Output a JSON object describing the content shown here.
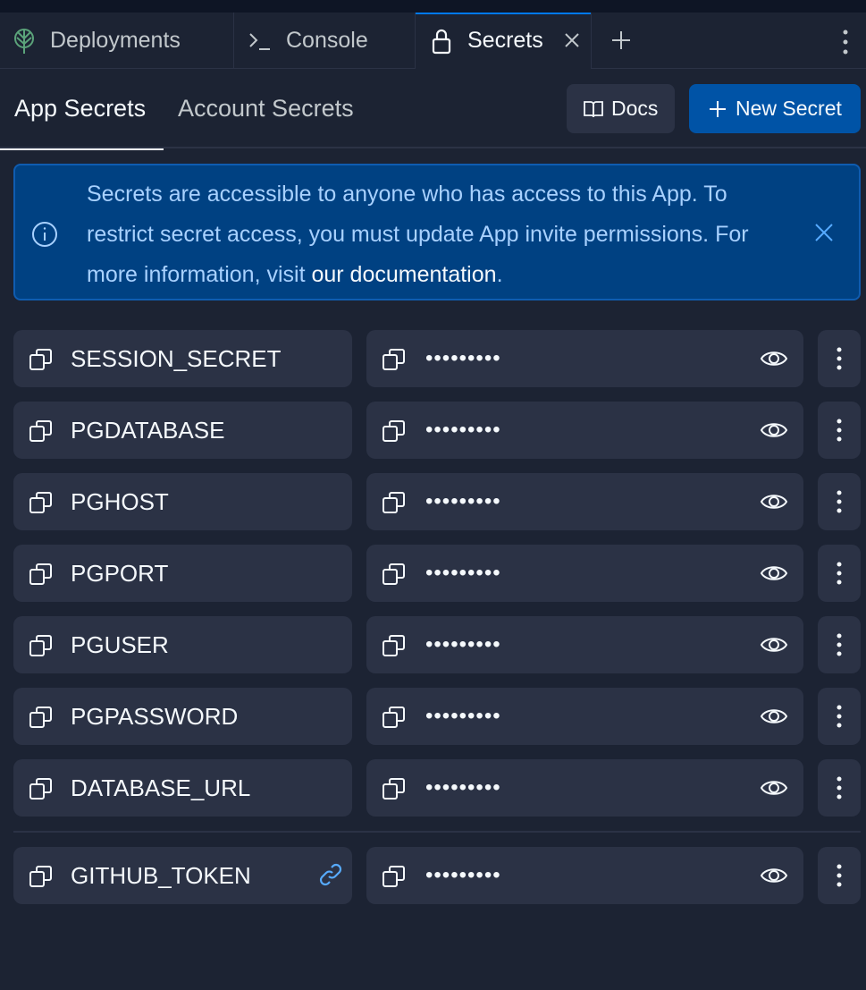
{
  "tabs": [
    {
      "label": "Deployments",
      "icon": "deployments-icon"
    },
    {
      "label": "Console",
      "icon": "console-icon"
    },
    {
      "label": "Secrets",
      "icon": "lock-icon",
      "active": true
    }
  ],
  "subtabs": {
    "app": "App Secrets",
    "account": "Account Secrets"
  },
  "buttons": {
    "docs": "Docs",
    "new_secret": "New Secret"
  },
  "banner": {
    "text": "Secrets are accessible to anyone who has access to this App. To restrict secret access, you must update App invite permissions. For more information, visit ",
    "link": "our documentation",
    "end": "."
  },
  "secrets": [
    {
      "name": "SESSION_SECRET",
      "value": "•••••••••"
    },
    {
      "name": "PGDATABASE",
      "value": "•••••••••"
    },
    {
      "name": "PGHOST",
      "value": "•••••••••"
    },
    {
      "name": "PGPORT",
      "value": "•••••••••"
    },
    {
      "name": "PGUSER",
      "value": "•••••••••"
    },
    {
      "name": "PGPASSWORD",
      "value": "•••••••••"
    },
    {
      "name": "DATABASE_URL",
      "value": "•••••••••"
    }
  ],
  "account_secrets": [
    {
      "name": "GITHUB_TOKEN",
      "value": "•••••••••",
      "linked": true
    }
  ],
  "colors": {
    "accent": "#0079f2",
    "primary_button": "#0053a6",
    "banner_bg": "#004182",
    "link_icon": "#57abff"
  }
}
